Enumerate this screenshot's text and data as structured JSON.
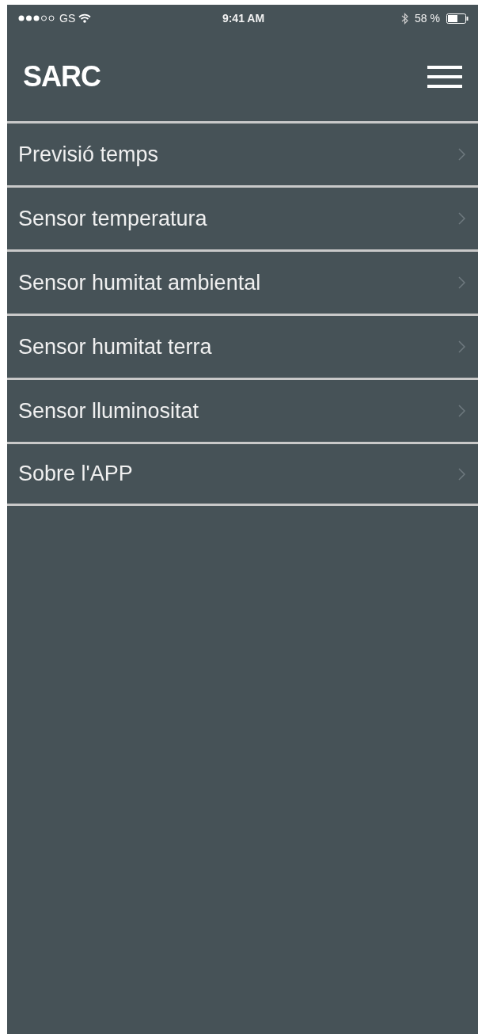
{
  "status_bar": {
    "carrier": "GS",
    "time": "9:41 AM",
    "battery": "58 %"
  },
  "header": {
    "title": "SARC"
  },
  "menu": [
    {
      "label": "Previsió temps"
    },
    {
      "label": "Sensor temperatura"
    },
    {
      "label": "Sensor humitat ambiental"
    },
    {
      "label": "Sensor humitat terra"
    },
    {
      "label": "Sensor lluminositat"
    },
    {
      "label": "Sobre l'APP"
    }
  ]
}
